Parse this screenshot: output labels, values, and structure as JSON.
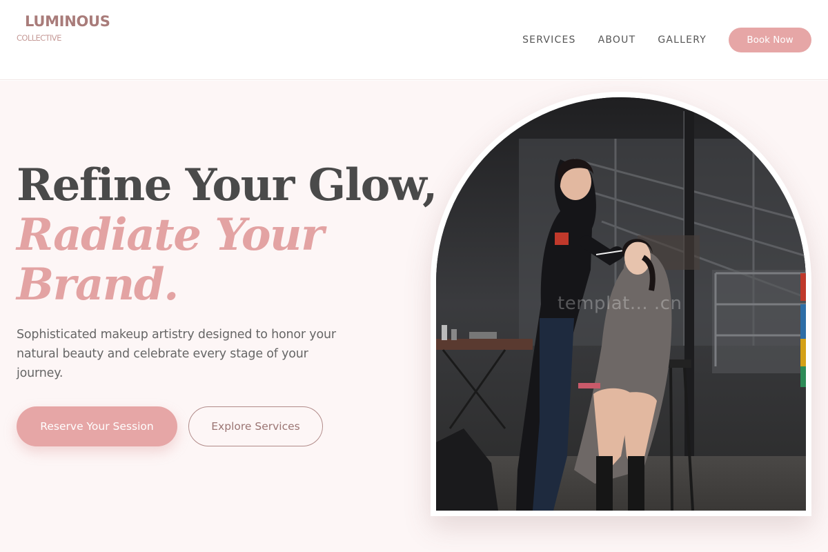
{
  "brand": {
    "name": "LUMINOUS",
    "tagline": "COLLECTIVE"
  },
  "nav": {
    "links": [
      "SERVICES",
      "ABOUT",
      "GALLERY"
    ],
    "cta_label": "Book Now"
  },
  "hero": {
    "headline_line1": "Refine Your Glow,",
    "headline_line2": "Radiate Your",
    "headline_line3": "Brand.",
    "subcopy": "Sophisticated makeup artistry designed to honor your natural beauty and celebrate every stage of your journey.",
    "primary_cta": "Reserve Your Session",
    "secondary_cta": "Explore Services",
    "image_watermark": "templat... .cn"
  },
  "colors": {
    "accent": "#e6a6a6",
    "brand": "#a97c7a",
    "hero_bg": "#fdf6f6",
    "heading": "#4a4a4a"
  },
  "icons": {}
}
